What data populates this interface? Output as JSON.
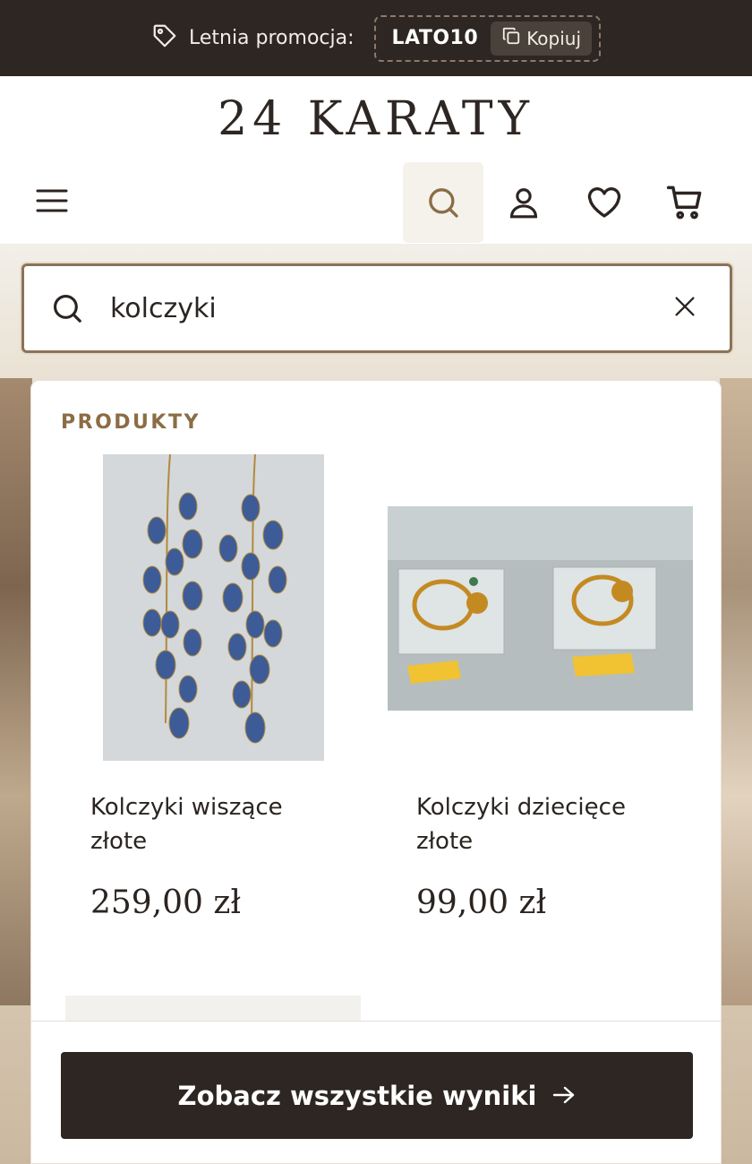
{
  "promo": {
    "label": "Letnia promocja:",
    "code": "LATO10",
    "copy_label": "Kopiuj"
  },
  "brand": {
    "logo_text": "24 KARATY"
  },
  "nav": {
    "icons": [
      "menu-icon",
      "search-icon",
      "account-icon",
      "wishlist-icon",
      "cart-icon"
    ]
  },
  "search": {
    "value": "kolczyki",
    "placeholder": ""
  },
  "results": {
    "heading": "PRODUKTY",
    "products": [
      {
        "name": "Kolczyki wiszące złote",
        "price": "259,00 zł"
      },
      {
        "name": "Kolczyki dziecięce złote",
        "price": "99,00 zł"
      }
    ],
    "see_all_label": "Zobacz wszystkie wyniki"
  },
  "colors": {
    "dark": "#2d2622",
    "accent_gold": "#8b6d45",
    "search_border": "#8b7358"
  }
}
